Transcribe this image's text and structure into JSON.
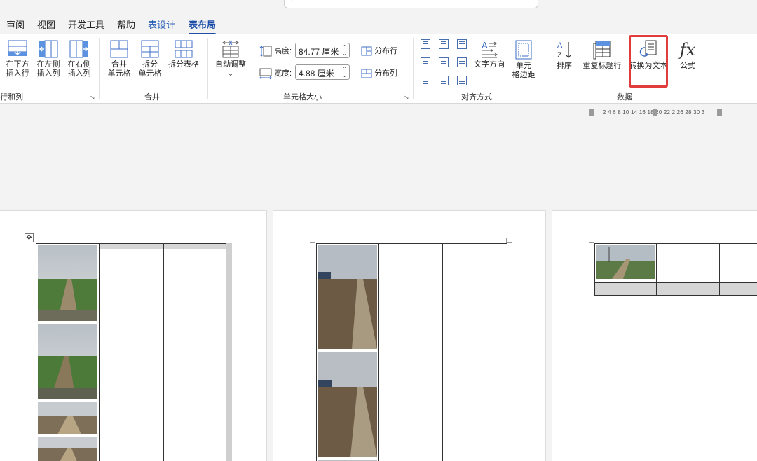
{
  "tabs": [
    "审阅",
    "视图",
    "开发工具",
    "帮助",
    "表设计",
    "表布局"
  ],
  "active_tab": "表布局",
  "ribbon": {
    "rows_cols": {
      "group_label": "行和列",
      "insert_below": [
        "在下方",
        "插入行"
      ],
      "insert_left": [
        "在左侧",
        "插入列"
      ],
      "insert_right": [
        "在右侧",
        "插入列"
      ]
    },
    "merge": {
      "group_label": "合并",
      "merge_cells": [
        "合并",
        "单元格"
      ],
      "split_cells": [
        "拆分",
        "单元格"
      ],
      "split_table": "拆分表格"
    },
    "cell_size": {
      "group_label": "单元格大小",
      "autofit": "自动调整",
      "height_label": "高度:",
      "height_value": "84.77 厘米",
      "width_label": "宽度:",
      "width_value": "4.88 厘米",
      "distribute_rows": "分布行",
      "distribute_cols": "分布列"
    },
    "alignment": {
      "group_label": "对齐方式",
      "text_direction": "文字方向",
      "cell_margins": [
        "单元",
        "格边距"
      ]
    },
    "data": {
      "group_label": "数据",
      "sort": "排序",
      "repeat_header": "重复标题行",
      "convert_to_text": "转换为文本",
      "formula": "公式"
    }
  },
  "ruler": {
    "numbers": "2 4 6 8 10  14 16 18 20 22 2  26 28 30 3"
  },
  "colors": {
    "accent": "#1e4fa8",
    "context_tab": "#2b5eb5",
    "highlight": "#e03c3c"
  }
}
